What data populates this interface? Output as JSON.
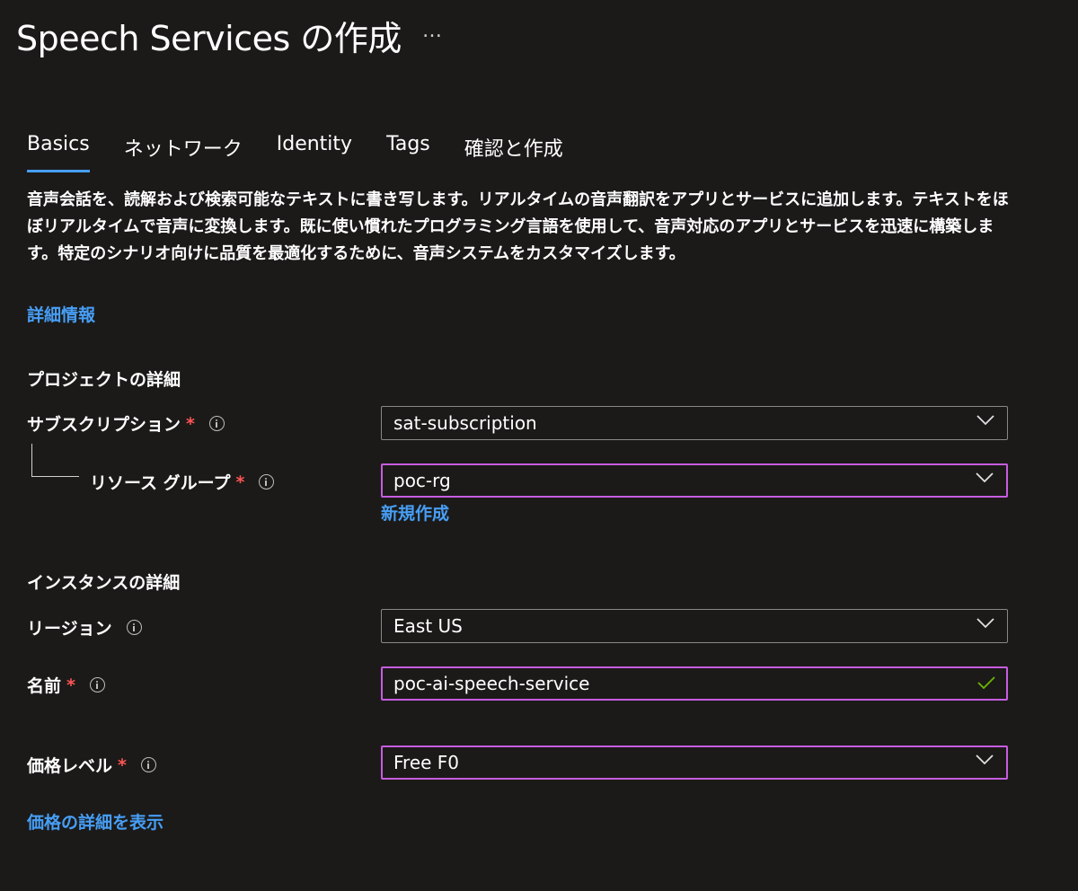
{
  "header": {
    "title": "Speech Services の作成",
    "more_label": "…"
  },
  "tabs": [
    {
      "label": "Basics",
      "active": true
    },
    {
      "label": "ネットワーク",
      "active": false
    },
    {
      "label": "Identity",
      "active": false
    },
    {
      "label": "Tags",
      "active": false
    },
    {
      "label": "確認と作成",
      "active": false
    }
  ],
  "description": {
    "text": "音声会話を、読解および検索可能なテキストに書き写します。リアルタイムの音声翻訳をアプリとサービスに追加します。テキストをほぼリアルタイムで音声に変換します。既に使い慣れたプログラミング言語を使用して、音声対応のアプリとサービスを迅速に構築します。特定のシナリオ向けに品質を最適化するために、音声システムをカスタマイズします。",
    "learn_more": "詳細情報"
  },
  "project_details": {
    "title": "プロジェクトの詳細",
    "subscription": {
      "label": "サブスクリプション",
      "required": "*",
      "value": "sat-subscription"
    },
    "resource_group": {
      "label": "リソース グループ",
      "required": "*",
      "value": "poc-rg",
      "create_new": "新規作成"
    }
  },
  "instance_details": {
    "title": "インスタンスの詳細",
    "region": {
      "label": "リージョン",
      "value": "East US"
    },
    "name": {
      "label": "名前",
      "required": "*",
      "value": "poc-ai-speech-service"
    }
  },
  "pricing": {
    "label": "価格レベル",
    "required": "*",
    "value": "Free F0",
    "details_link": "価格の詳細を表示"
  },
  "colors": {
    "background": "#1b1a19",
    "accent": "#479ef5",
    "focus_border": "#c75ce0",
    "required": "#ff5555",
    "valid": "#6bb700"
  },
  "icons": {
    "info": "info-icon",
    "dropdown": "chevron-down-icon",
    "valid": "check-icon"
  }
}
